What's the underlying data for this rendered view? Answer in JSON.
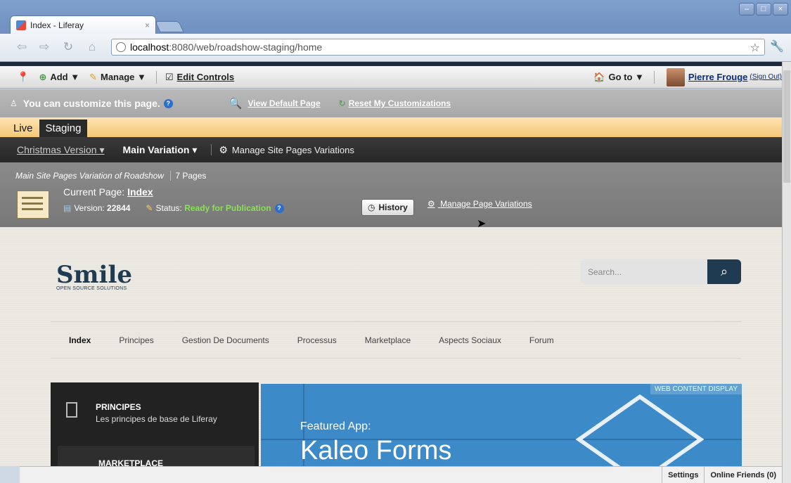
{
  "browser": {
    "tab_title": "Index - Liferay",
    "tab_close": "×",
    "url_host": "localhost",
    "url_path": ":8080/web/roadshow-staging/home",
    "win_buttons": [
      "–",
      "□",
      "×"
    ]
  },
  "dockbar": {
    "add": "Add ▼",
    "manage": "Manage ▼",
    "edit_controls": "Edit Controls",
    "goto": "Go to ▼",
    "user": "Pierre Frouge",
    "signout": "(Sign Out)"
  },
  "customize": {
    "message": "You can customize this page.",
    "view_default": "View Default Page",
    "reset": "Reset My Customizations"
  },
  "staging": {
    "tabs": [
      "Live",
      "Staging"
    ],
    "active": "Staging"
  },
  "variations": {
    "christmas": "Christmas Version ▾",
    "main": "Main Variation ▾",
    "manage": "Manage Site Pages Variations"
  },
  "page_variation": {
    "heading": "Main Site Pages Variation of Roadshow",
    "pages": "7 Pages",
    "current_label": "Current Page:",
    "current_page": "Index",
    "version_label": "Version:",
    "version": "22844",
    "status_label": "Status:",
    "status": "Ready for Publication",
    "history": "History",
    "manage": "Manage Page Variations"
  },
  "site": {
    "logo": "Smile",
    "logo_sub": "OPEN SOURCE SOLUTIONS",
    "search_placeholder": "Search...",
    "nav": [
      "Index",
      "Principes",
      "Gestion De Documents",
      "Processus",
      "Marketplace",
      "Aspects Sociaux",
      "Forum"
    ],
    "principes_title": "PRINCIPES",
    "principes_sub": "Les principes de base de Liferay",
    "marketplace_title": "MARKETPLACE",
    "wcd_label": "WEB CONTENT DISPLAY",
    "featured": "Featured App:",
    "kaleo": "Kaleo Forms"
  },
  "bottom": {
    "settings": "Settings",
    "online": "Online Friends (0)"
  }
}
